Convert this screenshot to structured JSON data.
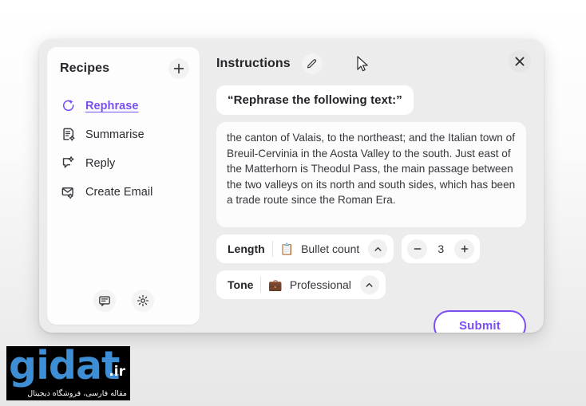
{
  "sidebar": {
    "title": "Recipes",
    "add_button": "+",
    "items": [
      {
        "label": "Rephrase",
        "icon": "refresh-sparkle-icon",
        "active": true
      },
      {
        "label": "Summarise",
        "icon": "document-sparkle-icon",
        "active": false
      },
      {
        "label": "Reply",
        "icon": "speech-bubble-sparkle-icon",
        "active": false
      },
      {
        "label": "Create Email",
        "icon": "envelope-sparkle-icon",
        "active": false
      }
    ],
    "footer": [
      {
        "icon": "feedback-icon"
      },
      {
        "icon": "gear-icon"
      }
    ]
  },
  "panel": {
    "title": "Instructions",
    "edit_icon": "pencil-icon",
    "close_icon": "close-icon",
    "prompt": "“Rephrase the following text:”",
    "body_text": "the canton of Valais, to the northeast; and the Italian town of Breuil-Cervinia in the Aosta Valley to the south. Just east of the Matterhorn is Theodul Pass, the main passage between the two valleys on its north and south sides, which has been a trade route since the Roman Era.",
    "length": {
      "label": "Length",
      "emoji": "📋",
      "icon": "clipboard-icon",
      "value": "Bullet count",
      "chevron": "chevron-up-icon"
    },
    "count": {
      "decrement": "−",
      "value": "3",
      "increment": "+"
    },
    "tone": {
      "label": "Tone",
      "emoji": "💼",
      "icon": "briefcase-icon",
      "value": "Professional",
      "chevron": "chevron-up-icon"
    },
    "submit_label": "Submit"
  },
  "watermark": {
    "text": "gidat",
    "tld": ".ir",
    "subtitle": "مقاله فارسی، فروشگاه دیجیتال"
  },
  "colors": {
    "accent": "#7b4ef5",
    "panel_bg": "#edecec",
    "card_bg": "#fdfdfd",
    "text": "#26272b"
  }
}
